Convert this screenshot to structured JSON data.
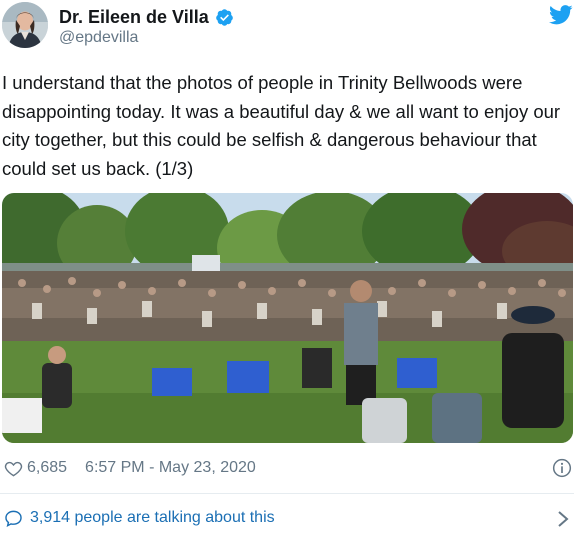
{
  "author": {
    "display_name": "Dr. Eileen de Villa",
    "handle": "@epdevilla",
    "verified": true,
    "avatar_icon": "profile-photo"
  },
  "tweet": {
    "text": "I understand that the photos of people in Trinity Bellwoods were disappointing today. It was a beautiful day & we all want to enjoy our city together, but this could be selfish & dangerous behaviour that could set us back. (1/3)",
    "photo_icon": "crowded-park-photo"
  },
  "stats": {
    "likes": "6,685",
    "timestamp": "6:57 PM - May 23, 2020"
  },
  "conversation": {
    "label": "3,914 people are talking about this"
  },
  "icons": {
    "brand": "twitter-bird-icon",
    "verified": "verified-badge-icon",
    "like": "heart-icon",
    "info": "info-icon",
    "reply": "speech-bubble-icon",
    "more": "chevron-right-icon"
  },
  "colors": {
    "twitter_blue": "#1da1f2",
    "link_blue": "#1b6fb4",
    "secondary_text": "#657786",
    "text": "#14171a"
  }
}
